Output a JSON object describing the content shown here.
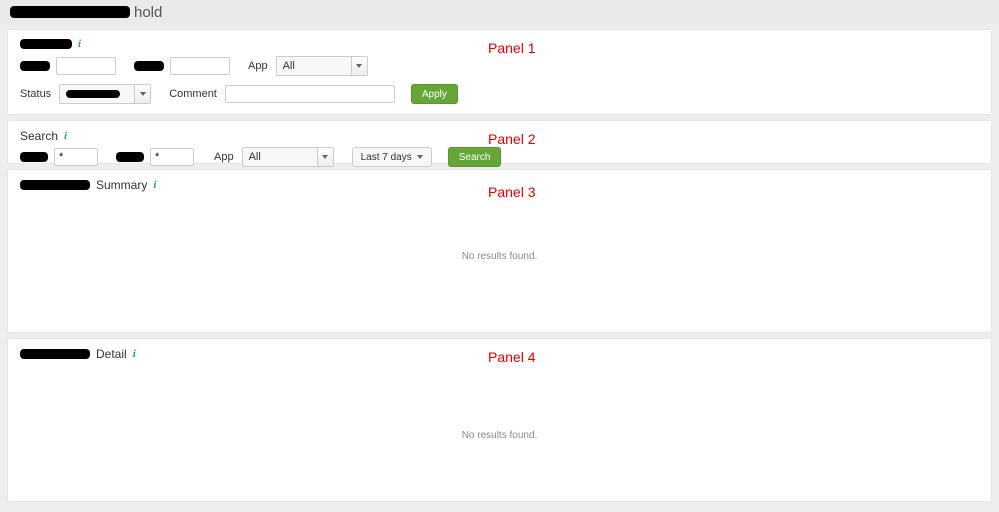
{
  "header": {
    "title_suffix": "hold"
  },
  "panel1": {
    "label_app": "App",
    "app_value": "All",
    "label_status": "Status",
    "label_comment": "Comment",
    "status_value": "",
    "comment_value": "",
    "input1_value": "",
    "input2_value": "",
    "apply_label": "Apply",
    "annotation": "Panel 1"
  },
  "panel2": {
    "title": "Search",
    "label_app": "App",
    "app_value": "All",
    "input1_value": "*",
    "input2_value": "*",
    "range_label": "Last 7 days",
    "search_label": "Search",
    "annotation": "Panel 2"
  },
  "panel3": {
    "title": "Summary",
    "no_results": "No results found.",
    "annotation": "Panel 3"
  },
  "panel4": {
    "title": "Detail",
    "no_results": "No results found.",
    "annotation": "Panel 4"
  }
}
